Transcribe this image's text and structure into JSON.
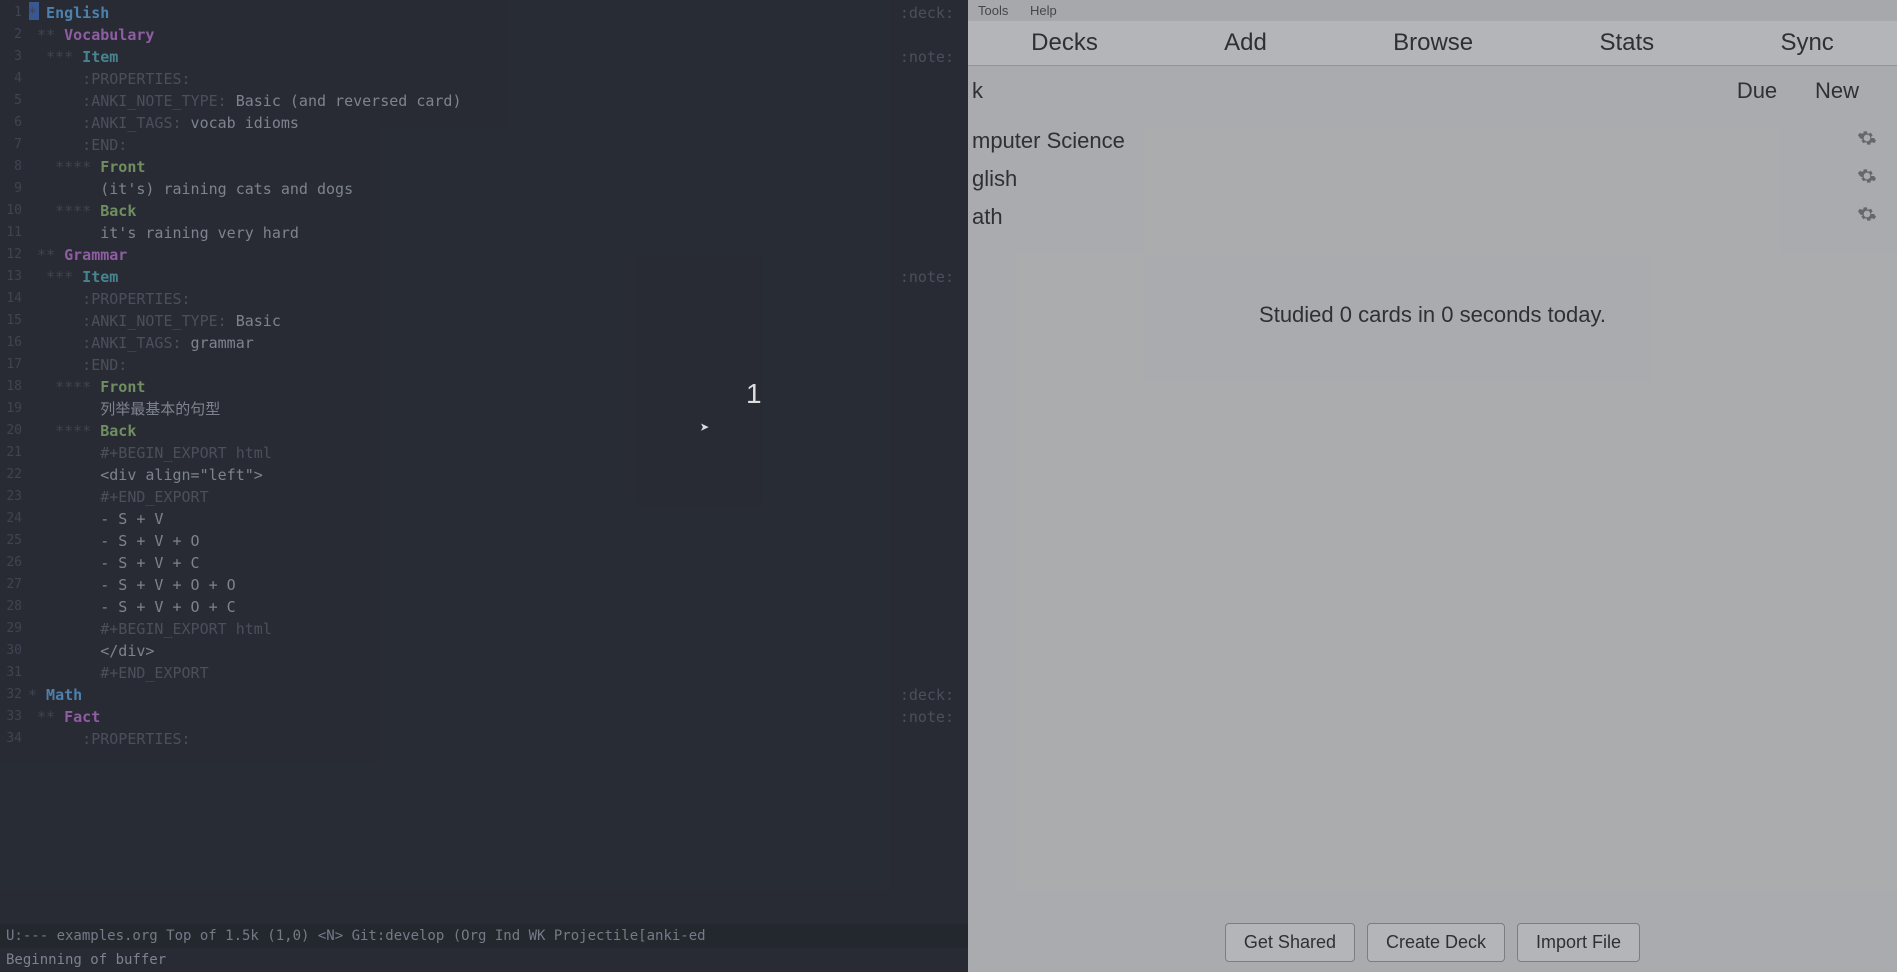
{
  "editor": {
    "gutter": [
      "1",
      "2",
      "3",
      "4",
      "5",
      "6",
      "7",
      "8",
      "9",
      "10",
      "11",
      "12",
      "13",
      "14",
      "15",
      "16",
      "17",
      "18",
      "19",
      "20",
      "21",
      "22",
      "23",
      "24",
      "25",
      "26",
      "27",
      "28",
      "29",
      "30",
      "31",
      "32",
      "33",
      "34"
    ],
    "l1_star": "*",
    "l1_head": " English",
    "l1_tag": ":deck:",
    "l2_star": " **",
    "l2_head": " Vocabulary",
    "l3_star": "  ***",
    "l3_head": " Item",
    "l3_tag": ":note:",
    "l4": "      :PROPERTIES:",
    "l5_k": "      :ANKI_NOTE_TYPE:",
    "l5_v": " Basic (and reversed card)",
    "l6_k": "      :ANKI_TAGS:",
    "l6_v": " vocab idioms",
    "l7": "      :END:",
    "l8_star": "   ****",
    "l8_head": " Front",
    "l9": "        (it's) raining cats and dogs",
    "l10_star": "   ****",
    "l10_head": " Back",
    "l11": "        it's raining very hard",
    "l12_star": " **",
    "l12_head": " Grammar",
    "l13_star": "  ***",
    "l13_head": " Item",
    "l13_tag": ":note:",
    "l14": "      :PROPERTIES:",
    "l15_k": "      :ANKI_NOTE_TYPE:",
    "l15_v": " Basic",
    "l16_k": "      :ANKI_TAGS:",
    "l16_v": " grammar",
    "l17": "      :END:",
    "l18_star": "   ****",
    "l18_head": " Front",
    "l19": "        列举最基本的句型",
    "l20_star": "   ****",
    "l20_head": " Back",
    "l21": "        #+BEGIN_EXPORT html",
    "l22": "        <div align=\"left\">",
    "l23": "        #+END_EXPORT",
    "l24": "        - S + V",
    "l25": "        - S + V + O",
    "l26": "        - S + V + C",
    "l27": "        - S + V + O + O",
    "l28": "        - S + V + O + C",
    "l29": "        #+BEGIN_EXPORT html",
    "l30": "        </div>",
    "l31": "        #+END_EXPORT",
    "l32_star": "*",
    "l32_head": " Math",
    "l32_tag": ":deck:",
    "l33_star": " **",
    "l33_head": " Fact",
    "l33_tag": ":note:",
    "l34": "      :PROPERTIES:",
    "modeline": "U:---  examples.org   Top of 1.5k (1,0)     <N>   Git:develop  (Org Ind WK Projectile[anki-ed",
    "echo": "Beginning of buffer",
    "msg": "1"
  },
  "anki": {
    "menu": {
      "tools": "Tools",
      "help": "Help"
    },
    "tabs": {
      "decks": "Decks",
      "add": "Add",
      "browse": "Browse",
      "stats": "Stats",
      "sync": "Sync"
    },
    "header": {
      "deck": "k",
      "due": "Due",
      "new": "New"
    },
    "rows": [
      {
        "name": "mputer Science"
      },
      {
        "name": "glish"
      },
      {
        "name": "ath"
      }
    ],
    "study": "Studied 0 cards in 0 seconds today.",
    "buttons": {
      "shared": "Get Shared",
      "create": "Create Deck",
      "import": "Import File"
    }
  }
}
